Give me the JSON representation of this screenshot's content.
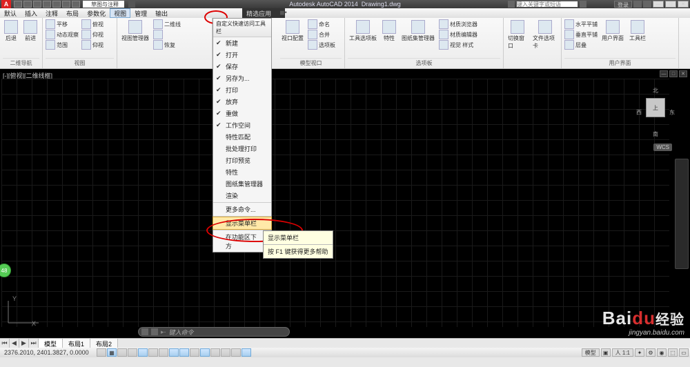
{
  "title": {
    "app": "Autodesk AutoCAD 2014",
    "doc": "Drawing1.dwg"
  },
  "search_placeholder": "键入关键字或短语",
  "login": "登录",
  "workspace_combo": "草图与注释",
  "menubar": [
    "默认",
    "插入",
    "注释",
    "布局",
    "参数化",
    "视图",
    "管理",
    "输出"
  ],
  "dd_header": "自定义快速访问工具栏",
  "dropdown": [
    {
      "chk": true,
      "label": "新建"
    },
    {
      "chk": true,
      "label": "打开"
    },
    {
      "chk": true,
      "label": "保存"
    },
    {
      "chk": true,
      "label": "另存为..."
    },
    {
      "chk": true,
      "label": "打印"
    },
    {
      "chk": true,
      "label": "放弃"
    },
    {
      "chk": true,
      "label": "重做"
    },
    {
      "chk": true,
      "label": "工作空间"
    },
    {
      "chk": false,
      "label": "特性匹配"
    },
    {
      "chk": false,
      "label": "批处理打印"
    },
    {
      "chk": false,
      "label": "打印预览"
    },
    {
      "chk": false,
      "label": "特性"
    },
    {
      "chk": false,
      "label": "图纸集管理器"
    },
    {
      "chk": false,
      "label": "渲染"
    },
    {
      "chk": false,
      "label": "更多命令..."
    },
    {
      "chk": false,
      "label": "显示菜单栏",
      "hl": true
    },
    {
      "chk": false,
      "label": "在功能区下方"
    }
  ],
  "tooltip": {
    "line1": "显示菜单栏",
    "line2": "按 F1 键获得更多帮助"
  },
  "ribbon_tabs_extra": "精选应用",
  "panels": {
    "p1": {
      "title": "二维导航",
      "items": [
        "平移",
        "动态观察",
        "范围"
      ],
      "right": [
        "俯视",
        "仰视",
        "仰视"
      ]
    },
    "p2": {
      "title": "视图",
      "items": [
        "视图管理器"
      ],
      "right": [
        "二维线",
        "后退",
        "前进",
        "恢复"
      ]
    },
    "p3": {
      "title": "模型视口",
      "items": [
        "视口配置",
        "命名",
        "合并",
        "选项板"
      ]
    },
    "p4": {
      "title": "选项板",
      "items": [
        "工具选项板",
        "特性",
        "图纸集管理器"
      ],
      "right": [
        "材质浏览器",
        "材质编辑器",
        "视觉 样式"
      ]
    },
    "p5": {
      "title": "",
      "items": [
        "切换窗口",
        "文件选项卡"
      ]
    },
    "p6": {
      "title": "用户界面",
      "items": [
        "水平平铺",
        "垂直平铺",
        "层叠"
      ],
      "right": [
        "用户界面",
        "工具栏"
      ]
    }
  },
  "history": {
    "back": "后退",
    "fwd": "前进"
  },
  "view_label": "[-][俯视][二维线框]",
  "viewcube": {
    "n": "北",
    "s": "南",
    "e": "东",
    "w": "西",
    "top": "上"
  },
  "wcs": "WCS",
  "green_badge": "48",
  "cmd_prompt": "键入命令",
  "tabs": {
    "model": "模型",
    "layout1": "布局1",
    "layout2": "布局2"
  },
  "coords": "2376.2010, 2401.3827, 0.0000",
  "status_right": {
    "space": "模型",
    "scale": "人 1:1"
  },
  "watermark": {
    "brand_a": "Bai",
    "brand_b": "du",
    "brand_c": "经验",
    "by": "jingyan.baidu.com"
  }
}
